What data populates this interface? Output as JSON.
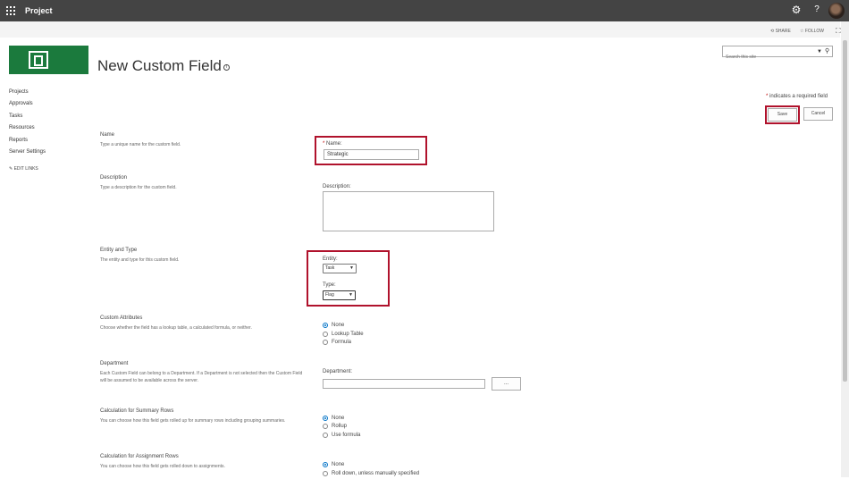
{
  "suite_bar": {
    "app_name": "Project",
    "background": "#444444"
  },
  "action_bar": {
    "share_label": "SHARE",
    "follow_label": "FOLLOW"
  },
  "logo": {
    "color": "#1b7a3d"
  },
  "page": {
    "title": "New Custom Field"
  },
  "search": {
    "placeholder": "Search this site"
  },
  "left_nav": {
    "items": [
      "Projects",
      "Approvals",
      "Tasks",
      "Resources",
      "Reports",
      "Server Settings"
    ],
    "edit_links": "EDIT LINKS"
  },
  "form": {
    "required_note": "indicates a required field",
    "required_star": "*",
    "save_label": "Save",
    "cancel_label": "Cancel",
    "highlight_color": "#b0122c",
    "name_section": {
      "title": "Name",
      "desc": "Type a unique name for the custom field.",
      "field_label": "Name:",
      "value": "Strategic"
    },
    "description_section": {
      "title": "Description",
      "desc": "Type a description for the custom field.",
      "field_label": "Description:",
      "value": ""
    },
    "entity_type_section": {
      "title": "Entity and Type",
      "desc": "The entity and type for this custom field.",
      "entity_label": "Entity:",
      "entity_value": "Task",
      "type_label": "Type:",
      "type_value": "Flag"
    },
    "custom_attributes": {
      "title": "Custom Attributes",
      "desc": "Choose whether the field has a lookup table, a calculated formula, or neither.",
      "options": [
        "None",
        "Lookup Table",
        "Formula"
      ],
      "selected": "None"
    },
    "department": {
      "title": "Department",
      "desc": "Each Custom Field can belong to a Department. If a Department is not selected then the Custom Field will be assumed to be available across the server.",
      "field_label": "Department:",
      "value": "",
      "browse_label": "..."
    },
    "summary_rows": {
      "title": "Calculation for Summary Rows",
      "desc": "You can choose how this field gets rolled up for summary rows including grouping summaries.",
      "options": [
        "None",
        "Rollup",
        "Use formula"
      ],
      "selected": "None"
    },
    "assignment_rows": {
      "title": "Calculation for Assignment Rows",
      "desc": "You can choose how this field gets rolled down to assignments.",
      "options": [
        "None",
        "Roll down, unless manually specified"
      ],
      "selected": "None"
    }
  },
  "accent_color": "#0072c6"
}
